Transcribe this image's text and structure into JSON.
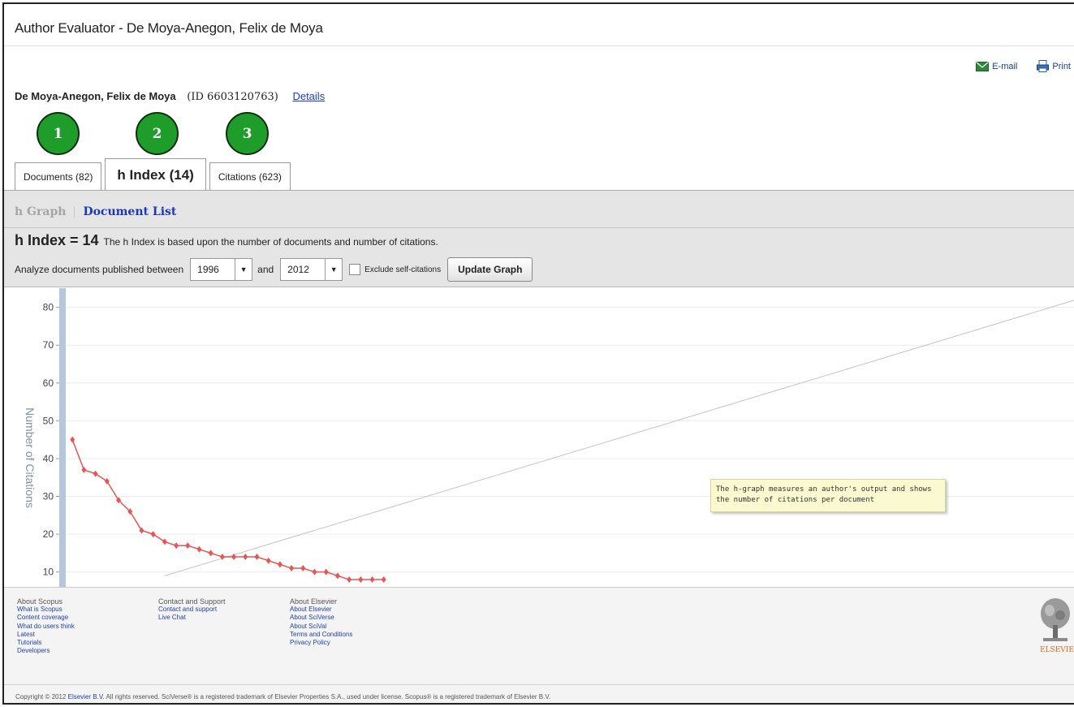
{
  "window": {
    "title": "Author Evaluator - De Moya-Anegon, Felix de Moya"
  },
  "toolbar": {
    "email_label": "E-mail",
    "print_label": "Print"
  },
  "author": {
    "name": "De Moya-Anegon, Felix de Moya",
    "id_text": "(ID 6603120763)",
    "details_label": "Details"
  },
  "steps": [
    "1",
    "2",
    "3"
  ],
  "tabs": [
    {
      "label": "Documents (82)",
      "active": false
    },
    {
      "label": "h Index (14)",
      "active": true
    },
    {
      "label": "Citations (623)",
      "active": false
    }
  ],
  "subnav": {
    "graph_label": "h Graph",
    "list_label": "Document List"
  },
  "hindex": {
    "value_label": "h Index = 14",
    "description": "The h Index is based upon the number of documents and number of citations."
  },
  "filter": {
    "analyze_label": "Analyze documents published between",
    "from_year": "1996",
    "and_label": "and",
    "to_year": "2012",
    "exclude_label": "Exclude self-citations",
    "exclude_checked": false,
    "update_label": "Update Graph"
  },
  "tooltip": {
    "text": "The h-graph measures an author's output and shows the number of citations per document"
  },
  "chart_data": {
    "type": "line",
    "ylabel": "Number of Citations",
    "yticks": [
      10,
      20,
      30,
      40,
      50,
      60,
      70,
      80
    ],
    "ylim": [
      8,
      81
    ],
    "xlim": [
      0,
      88
    ],
    "grid": true,
    "series": [
      {
        "color": "#e85555",
        "values": [
          45,
          37,
          36,
          34,
          29,
          26,
          21,
          20,
          18,
          17,
          17,
          16,
          15,
          14,
          14,
          14,
          14,
          13,
          12,
          11,
          11,
          10,
          10,
          9,
          8,
          8,
          8,
          8
        ]
      },
      {
        "type": "reference-line",
        "color": "#c4c4c4",
        "x": [
          9,
          88
        ],
        "y": [
          9,
          82
        ]
      }
    ]
  },
  "footer": {
    "columns": [
      {
        "heading": "About Scopus",
        "links": [
          "What is Scopus",
          "Content coverage",
          "What do users think",
          "Latest",
          "Tutorials",
          "Developers"
        ]
      },
      {
        "heading": "Contact and Support",
        "links": [
          "Contact and support",
          "Live Chat"
        ]
      },
      {
        "heading": "About Elsevier",
        "links": [
          "About Elsevier",
          "About SciVerse",
          "About SciVal",
          "Terms and Conditions",
          "Privacy Policy"
        ]
      }
    ],
    "copyright_pre": "Copyright © 2012 ",
    "copyright_link": "Elsevier B.V",
    "copyright_post": ". All rights reserved. SciVerse® is a registered trademark of Elsevier Properties S.A., used under license. Scopus® is a registered trademark of Elsevier B.V.",
    "logo_text": "ELSEVIER"
  }
}
